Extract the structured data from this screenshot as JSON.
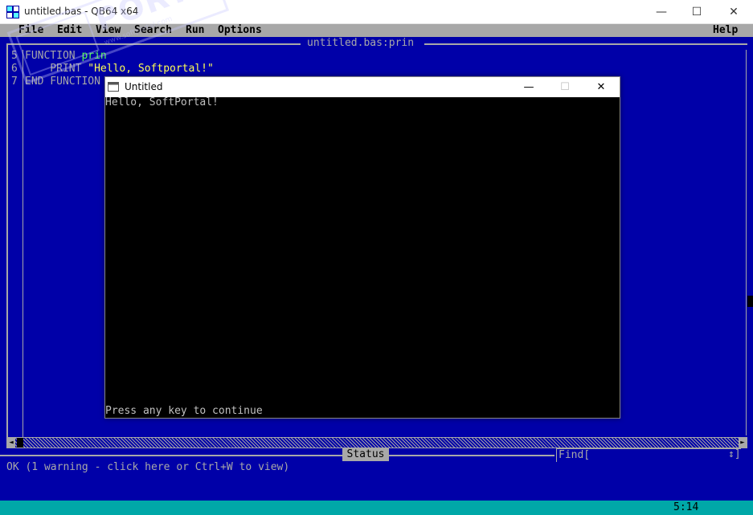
{
  "window": {
    "title": "untitled.bas - QB64 x64",
    "minimize": "—",
    "maximize": "☐",
    "close": "✕"
  },
  "menu": {
    "file": "File",
    "edit": "Edit",
    "view": "View",
    "search": "Search",
    "run": "Run",
    "options": "Options",
    "help": "Help"
  },
  "editor": {
    "doc_title": "untitled.bas:prin",
    "lines": [
      {
        "num": "5",
        "kw": "FUNCTION",
        "rest": " prin",
        "str": ""
      },
      {
        "num": "6",
        "kw": "    PRINT",
        "rest": " ",
        "str": "\"Hello, Softportal!\""
      },
      {
        "num": "7",
        "kw": "END FUNCTION",
        "rest": "",
        "str": ""
      }
    ]
  },
  "watermark": {
    "text": "PORTAL",
    "sub": "www.softportal.com"
  },
  "run_window": {
    "title": "Untitled",
    "minimize": "—",
    "maximize": "☐",
    "close": "✕",
    "output_line1": "Hello, SoftPortal!",
    "output_last": "Press any key to continue"
  },
  "status": {
    "label": "Status",
    "message": "OK (1 warning - click here or Ctrl+W to view)",
    "find_label": "Find[",
    "find_arrow": "↕]",
    "cursor_pos": "5:14"
  },
  "colors": {
    "bg": "#0000a8",
    "fg": "#a8a8a8",
    "keyword": "#55ff55",
    "string": "#ffff55",
    "bottom_bar": "#00a8a8"
  }
}
